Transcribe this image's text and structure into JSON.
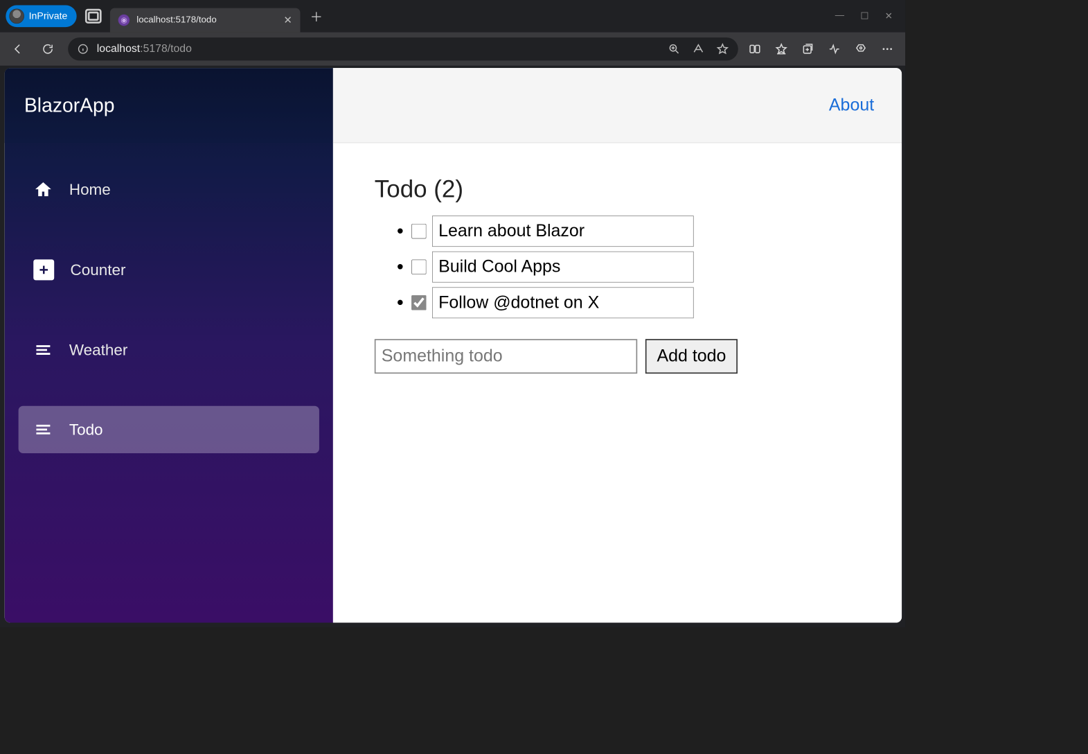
{
  "browser": {
    "inprivate_label": "InPrivate",
    "tab_title": "localhost:5178/todo",
    "url_host": "localhost",
    "url_rest": ":5178/todo"
  },
  "sidebar": {
    "brand": "BlazorApp",
    "items": [
      {
        "label": "Home",
        "icon": "home-icon",
        "active": false
      },
      {
        "label": "Counter",
        "icon": "plus-icon",
        "active": false
      },
      {
        "label": "Weather",
        "icon": "list-icon",
        "active": false
      },
      {
        "label": "Todo",
        "icon": "list-icon",
        "active": true
      }
    ]
  },
  "header": {
    "about_label": "About"
  },
  "todo": {
    "title": "Todo (2)",
    "items": [
      {
        "text": "Learn about Blazor",
        "done": false
      },
      {
        "text": "Build Cool Apps",
        "done": false
      },
      {
        "text": "Follow @dotnet on X",
        "done": true
      }
    ],
    "input_placeholder": "Something todo",
    "add_label": "Add todo"
  }
}
